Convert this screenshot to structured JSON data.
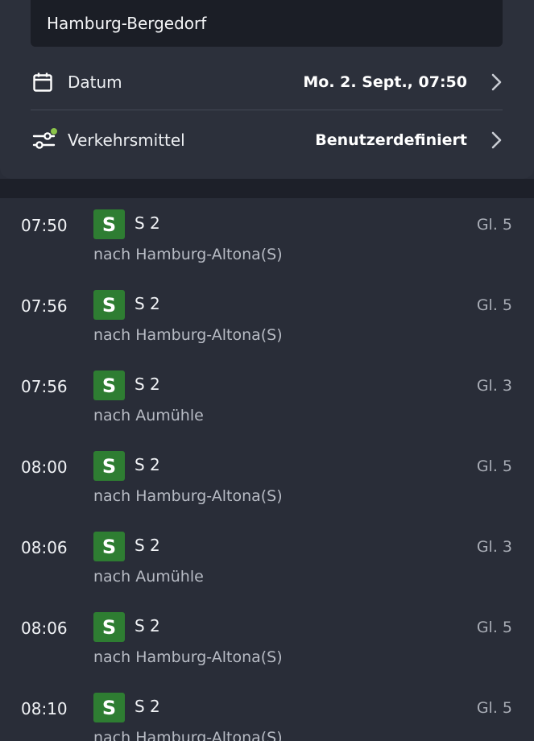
{
  "search": {
    "station": "Hamburg-Bergedorf"
  },
  "filters": {
    "date_label": "Datum",
    "date_value": "Mo. 2. Sept., 07:50",
    "transport_label": "Verkehrsmittel",
    "transport_value": "Benutzerdefiniert"
  },
  "colors": {
    "s_bahn_badge": "#2e7d32",
    "filter_active_dot": "#8bc34a",
    "background": "#292d38"
  },
  "departures": [
    {
      "time": "07:50",
      "badge": "S",
      "line": "S 2",
      "destination": "nach Hamburg-Altona(S)",
      "track": "Gl. 5"
    },
    {
      "time": "07:56",
      "badge": "S",
      "line": "S 2",
      "destination": "nach Hamburg-Altona(S)",
      "track": "Gl. 5"
    },
    {
      "time": "07:56",
      "badge": "S",
      "line": "S 2",
      "destination": "nach Aumühle",
      "track": "Gl. 3"
    },
    {
      "time": "08:00",
      "badge": "S",
      "line": "S 2",
      "destination": "nach Hamburg-Altona(S)",
      "track": "Gl. 5"
    },
    {
      "time": "08:06",
      "badge": "S",
      "line": "S 2",
      "destination": "nach Aumühle",
      "track": "Gl. 3"
    },
    {
      "time": "08:06",
      "badge": "S",
      "line": "S 2",
      "destination": "nach Hamburg-Altona(S)",
      "track": "Gl. 5"
    },
    {
      "time": "08:10",
      "badge": "S",
      "line": "S 2",
      "destination": "nach Hamburg-Altona(S)",
      "track": "Gl. 5"
    }
  ]
}
